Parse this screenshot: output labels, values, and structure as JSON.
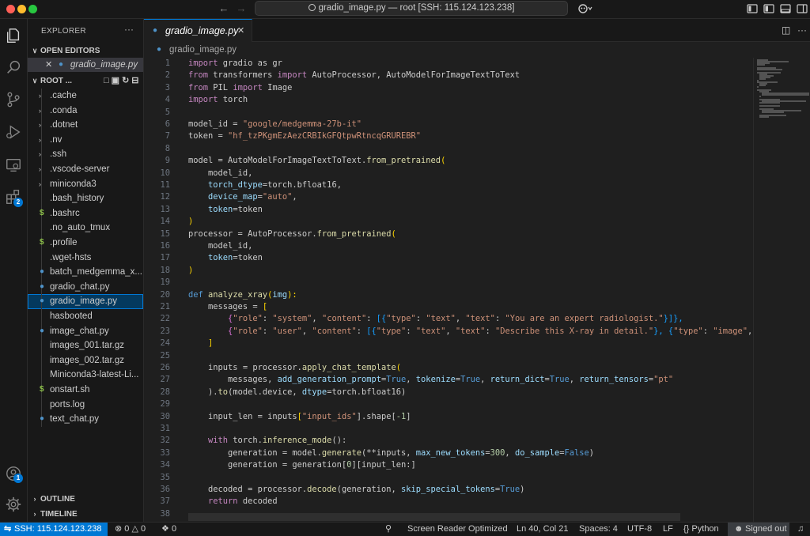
{
  "titlebar": {
    "command_center": "gradio_image.py — root [SSH: 115.124.123.238]"
  },
  "activity_bar": {
    "extensions_badge": "2",
    "accounts_badge": "1"
  },
  "sidebar": {
    "title": "EXPLORER",
    "more": "···",
    "open_editors_label": "OPEN EDITORS",
    "open_editor_file": "gradio_image.py",
    "root_label": "ROOT ...",
    "tree": [
      {
        "label": ".cache",
        "kind": "folder"
      },
      {
        "label": ".conda",
        "kind": "folder"
      },
      {
        "label": ".dotnet",
        "kind": "folder"
      },
      {
        "label": ".nv",
        "kind": "folder"
      },
      {
        "label": ".ssh",
        "kind": "folder"
      },
      {
        "label": ".vscode-server",
        "kind": "folder"
      },
      {
        "label": "miniconda3",
        "kind": "folder"
      },
      {
        "label": ".bash_history",
        "kind": "file"
      },
      {
        "label": ".bashrc",
        "kind": "shell"
      },
      {
        "label": ".no_auto_tmux",
        "kind": "file"
      },
      {
        "label": ".profile",
        "kind": "shell"
      },
      {
        "label": ".wget-hsts",
        "kind": "file"
      },
      {
        "label": "batch_medgemma_x...",
        "kind": "python"
      },
      {
        "label": "gradio_chat.py",
        "kind": "python"
      },
      {
        "label": "gradio_image.py",
        "kind": "python",
        "selected": true
      },
      {
        "label": "hasbooted",
        "kind": "file"
      },
      {
        "label": "image_chat.py",
        "kind": "python"
      },
      {
        "label": "images_001.tar.gz",
        "kind": "file"
      },
      {
        "label": "images_002.tar.gz",
        "kind": "file"
      },
      {
        "label": "Miniconda3-latest-Li...",
        "kind": "file"
      },
      {
        "label": "onstart.sh",
        "kind": "shell"
      },
      {
        "label": "ports.log",
        "kind": "file"
      },
      {
        "label": "text_chat.py",
        "kind": "python"
      }
    ],
    "outline_label": "OUTLINE",
    "timeline_label": "TIMELINE"
  },
  "editor": {
    "tab_label": "gradio_image.py",
    "breadcrumb": "gradio_image.py",
    "line_numbers": [
      "1",
      "2",
      "3",
      "4",
      "5",
      "6",
      "7",
      "8",
      "9",
      "10",
      "11",
      "12",
      "13",
      "14",
      "15",
      "16",
      "17",
      "18",
      "19",
      "20",
      "21",
      "22",
      "23",
      "24",
      "25",
      "26",
      "27",
      "28",
      "29",
      "30",
      "31",
      "32",
      "33",
      "34",
      "35",
      "36",
      "37",
      "38"
    ],
    "code": {
      "l1_kw": "import",
      "l1_rest": " gradio as gr",
      "l2_kw": "from",
      "l2_a": " transformers ",
      "l2_kw2": "import",
      "l2_b": " AutoProcessor, AutoModelForImageTextToText",
      "l3_kw": "from",
      "l3_a": " PIL ",
      "l3_kw2": "import",
      "l3_b": " Image",
      "l4_kw": "import",
      "l4_rest": " torch",
      "l6_a": "model_id = ",
      "l6_s": "\"google/medgemma-27b-it\"",
      "l7_a": "token = ",
      "l7_s": "\"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\"",
      "l9_a": "model = AutoModelForImageTextToText.",
      "l9_f": "from_pretrained",
      "l9_b": "(",
      "l10": "    model_id,",
      "l11_p": "torch_dtype",
      "l11_b": "=torch.bfloat16,",
      "l12_p": "device_map",
      "l12_b": "=",
      "l12_s": "\"auto\"",
      "l12_c": ",",
      "l13_p": "token",
      "l13_b": "=token",
      "l14": ")",
      "l15_a": "processor = AutoProcessor.",
      "l15_f": "from_pretrained",
      "l15_b": "(",
      "l16": "    model_id,",
      "l17_p": "token",
      "l17_b": "=token",
      "l18": ")",
      "l20_kw": "def",
      "l20_f": " analyze_xray",
      "l20_a": "(",
      "l20_p": "img",
      "l20_b": "):",
      "l21_a": "    messages = ",
      "l21_b": "[",
      "l22_a": "{",
      "l22_s1": "\"role\"",
      "l22_c1": ": ",
      "l22_s2": "\"system\"",
      "l22_c2": ", ",
      "l22_s3": "\"content\"",
      "l22_c3": ": ",
      "l22_br": "[{",
      "l22_s4": "\"type\"",
      "l22_c4": ": ",
      "l22_s5": "\"text\"",
      "l22_c5": ", ",
      "l22_s6": "\"text\"",
      "l22_c6": ": ",
      "l22_s7": "\"You are an expert radiologist.\"",
      "l22_end": "}]},",
      "l23_a": "{",
      "l23_s1": "\"role\"",
      "l23_c1": ": ",
      "l23_s2": "\"user\"",
      "l23_c2": ", ",
      "l23_s3": "\"content\"",
      "l23_c3": ": ",
      "l23_br": "[{",
      "l23_s4": "\"type\"",
      "l23_c4": ": ",
      "l23_s5": "\"text\"",
      "l23_c5": ", ",
      "l23_s6": "\"text\"",
      "l23_c6": ": ",
      "l23_s7": "\"Describe this X-ray in detail.\"",
      "l23_c7": "}, {",
      "l23_s8": "\"type\"",
      "l23_c8": ": ",
      "l23_s9": "\"image\"",
      "l23_c9": ", ",
      "l23_s10": "\"i",
      "l24": "    ]",
      "l26_a": "    inputs = processor.",
      "l26_f": "apply_chat_template",
      "l26_b": "(",
      "l27_a": "messages, ",
      "l27_p1": "add_generation_prompt",
      "l27_b": "=",
      "l27_k1": "True",
      "l27_c": ", ",
      "l27_p2": "tokenize",
      "l27_d": "=",
      "l27_k2": "True",
      "l27_e": ", ",
      "l27_p3": "return_dict",
      "l27_g": "=",
      "l27_k3": "True",
      "l27_h": ", ",
      "l27_p4": "return_tensors",
      "l27_i": "=",
      "l27_s": "\"pt\"",
      "l28_a": "    ).",
      "l28_f": "to",
      "l28_b": "(model.device, ",
      "l28_p": "dtype",
      "l28_c": "=torch.bfloat16)",
      "l30_a": "    input_len = inputs",
      "l30_b": "[",
      "l30_s": "\"input_ids\"",
      "l30_c": "].shape[",
      "l30_n": "-1",
      "l30_d": "]",
      "l32_kw": "    with",
      "l32_a": " torch.",
      "l32_f": "inference_mode",
      "l32_b": "():",
      "l33_a": "        generation = model.",
      "l33_f": "generate",
      "l33_b": "(**inputs, ",
      "l33_p1": "max_new_tokens",
      "l33_c": "=",
      "l33_n": "300",
      "l33_d": ", ",
      "l33_p2": "do_sample",
      "l33_e": "=",
      "l33_k": "False",
      "l33_g": ")",
      "l34_a": "        generation = generation",
      "l34_b": "[",
      "l34_n": "0",
      "l34_c": "][input_len:]",
      "l36_a": "    decoded = processor.",
      "l36_f": "decode",
      "l36_b": "(generation, ",
      "l36_p": "skip_special_tokens",
      "l36_c": "=",
      "l36_k": "True",
      "l36_d": ")",
      "l37_kw": "    return",
      "l37_a": " decoded"
    }
  },
  "statusbar": {
    "remote": "SSH: 115.124.123.238",
    "errors": "0",
    "warnings": "0",
    "ports": "0",
    "screen_reader": "Screen Reader Optimized",
    "position": "Ln 40, Col 21",
    "spaces": "Spaces: 4",
    "encoding": "UTF-8",
    "eol": "LF",
    "language": "Python",
    "signed_out": "Signed out"
  }
}
